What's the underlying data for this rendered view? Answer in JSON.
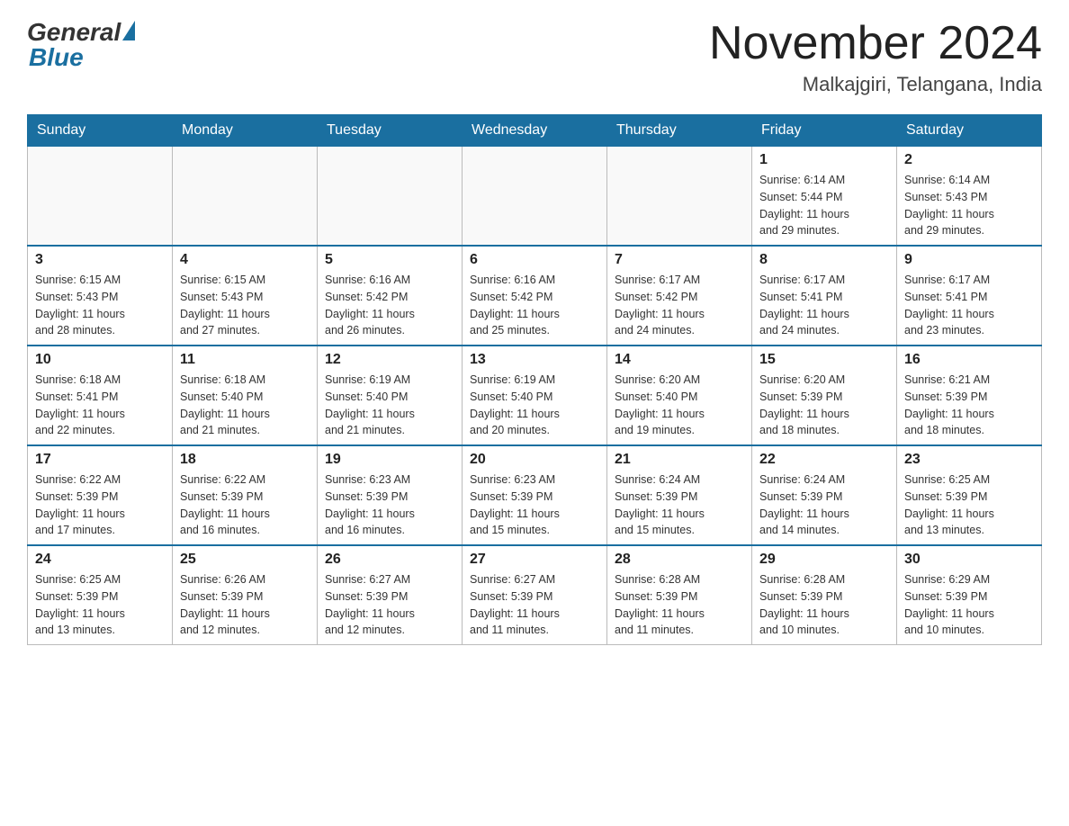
{
  "logo": {
    "general_text": "General",
    "blue_text": "Blue"
  },
  "header": {
    "month_year": "November 2024",
    "location": "Malkajgiri, Telangana, India"
  },
  "weekdays": [
    "Sunday",
    "Monday",
    "Tuesday",
    "Wednesday",
    "Thursday",
    "Friday",
    "Saturday"
  ],
  "weeks": [
    [
      {
        "day": "",
        "info": ""
      },
      {
        "day": "",
        "info": ""
      },
      {
        "day": "",
        "info": ""
      },
      {
        "day": "",
        "info": ""
      },
      {
        "day": "",
        "info": ""
      },
      {
        "day": "1",
        "info": "Sunrise: 6:14 AM\nSunset: 5:44 PM\nDaylight: 11 hours\nand 29 minutes."
      },
      {
        "day": "2",
        "info": "Sunrise: 6:14 AM\nSunset: 5:43 PM\nDaylight: 11 hours\nand 29 minutes."
      }
    ],
    [
      {
        "day": "3",
        "info": "Sunrise: 6:15 AM\nSunset: 5:43 PM\nDaylight: 11 hours\nand 28 minutes."
      },
      {
        "day": "4",
        "info": "Sunrise: 6:15 AM\nSunset: 5:43 PM\nDaylight: 11 hours\nand 27 minutes."
      },
      {
        "day": "5",
        "info": "Sunrise: 6:16 AM\nSunset: 5:42 PM\nDaylight: 11 hours\nand 26 minutes."
      },
      {
        "day": "6",
        "info": "Sunrise: 6:16 AM\nSunset: 5:42 PM\nDaylight: 11 hours\nand 25 minutes."
      },
      {
        "day": "7",
        "info": "Sunrise: 6:17 AM\nSunset: 5:42 PM\nDaylight: 11 hours\nand 24 minutes."
      },
      {
        "day": "8",
        "info": "Sunrise: 6:17 AM\nSunset: 5:41 PM\nDaylight: 11 hours\nand 24 minutes."
      },
      {
        "day": "9",
        "info": "Sunrise: 6:17 AM\nSunset: 5:41 PM\nDaylight: 11 hours\nand 23 minutes."
      }
    ],
    [
      {
        "day": "10",
        "info": "Sunrise: 6:18 AM\nSunset: 5:41 PM\nDaylight: 11 hours\nand 22 minutes."
      },
      {
        "day": "11",
        "info": "Sunrise: 6:18 AM\nSunset: 5:40 PM\nDaylight: 11 hours\nand 21 minutes."
      },
      {
        "day": "12",
        "info": "Sunrise: 6:19 AM\nSunset: 5:40 PM\nDaylight: 11 hours\nand 21 minutes."
      },
      {
        "day": "13",
        "info": "Sunrise: 6:19 AM\nSunset: 5:40 PM\nDaylight: 11 hours\nand 20 minutes."
      },
      {
        "day": "14",
        "info": "Sunrise: 6:20 AM\nSunset: 5:40 PM\nDaylight: 11 hours\nand 19 minutes."
      },
      {
        "day": "15",
        "info": "Sunrise: 6:20 AM\nSunset: 5:39 PM\nDaylight: 11 hours\nand 18 minutes."
      },
      {
        "day": "16",
        "info": "Sunrise: 6:21 AM\nSunset: 5:39 PM\nDaylight: 11 hours\nand 18 minutes."
      }
    ],
    [
      {
        "day": "17",
        "info": "Sunrise: 6:22 AM\nSunset: 5:39 PM\nDaylight: 11 hours\nand 17 minutes."
      },
      {
        "day": "18",
        "info": "Sunrise: 6:22 AM\nSunset: 5:39 PM\nDaylight: 11 hours\nand 16 minutes."
      },
      {
        "day": "19",
        "info": "Sunrise: 6:23 AM\nSunset: 5:39 PM\nDaylight: 11 hours\nand 16 minutes."
      },
      {
        "day": "20",
        "info": "Sunrise: 6:23 AM\nSunset: 5:39 PM\nDaylight: 11 hours\nand 15 minutes."
      },
      {
        "day": "21",
        "info": "Sunrise: 6:24 AM\nSunset: 5:39 PM\nDaylight: 11 hours\nand 15 minutes."
      },
      {
        "day": "22",
        "info": "Sunrise: 6:24 AM\nSunset: 5:39 PM\nDaylight: 11 hours\nand 14 minutes."
      },
      {
        "day": "23",
        "info": "Sunrise: 6:25 AM\nSunset: 5:39 PM\nDaylight: 11 hours\nand 13 minutes."
      }
    ],
    [
      {
        "day": "24",
        "info": "Sunrise: 6:25 AM\nSunset: 5:39 PM\nDaylight: 11 hours\nand 13 minutes."
      },
      {
        "day": "25",
        "info": "Sunrise: 6:26 AM\nSunset: 5:39 PM\nDaylight: 11 hours\nand 12 minutes."
      },
      {
        "day": "26",
        "info": "Sunrise: 6:27 AM\nSunset: 5:39 PM\nDaylight: 11 hours\nand 12 minutes."
      },
      {
        "day": "27",
        "info": "Sunrise: 6:27 AM\nSunset: 5:39 PM\nDaylight: 11 hours\nand 11 minutes."
      },
      {
        "day": "28",
        "info": "Sunrise: 6:28 AM\nSunset: 5:39 PM\nDaylight: 11 hours\nand 11 minutes."
      },
      {
        "day": "29",
        "info": "Sunrise: 6:28 AM\nSunset: 5:39 PM\nDaylight: 11 hours\nand 10 minutes."
      },
      {
        "day": "30",
        "info": "Sunrise: 6:29 AM\nSunset: 5:39 PM\nDaylight: 11 hours\nand 10 minutes."
      }
    ]
  ]
}
